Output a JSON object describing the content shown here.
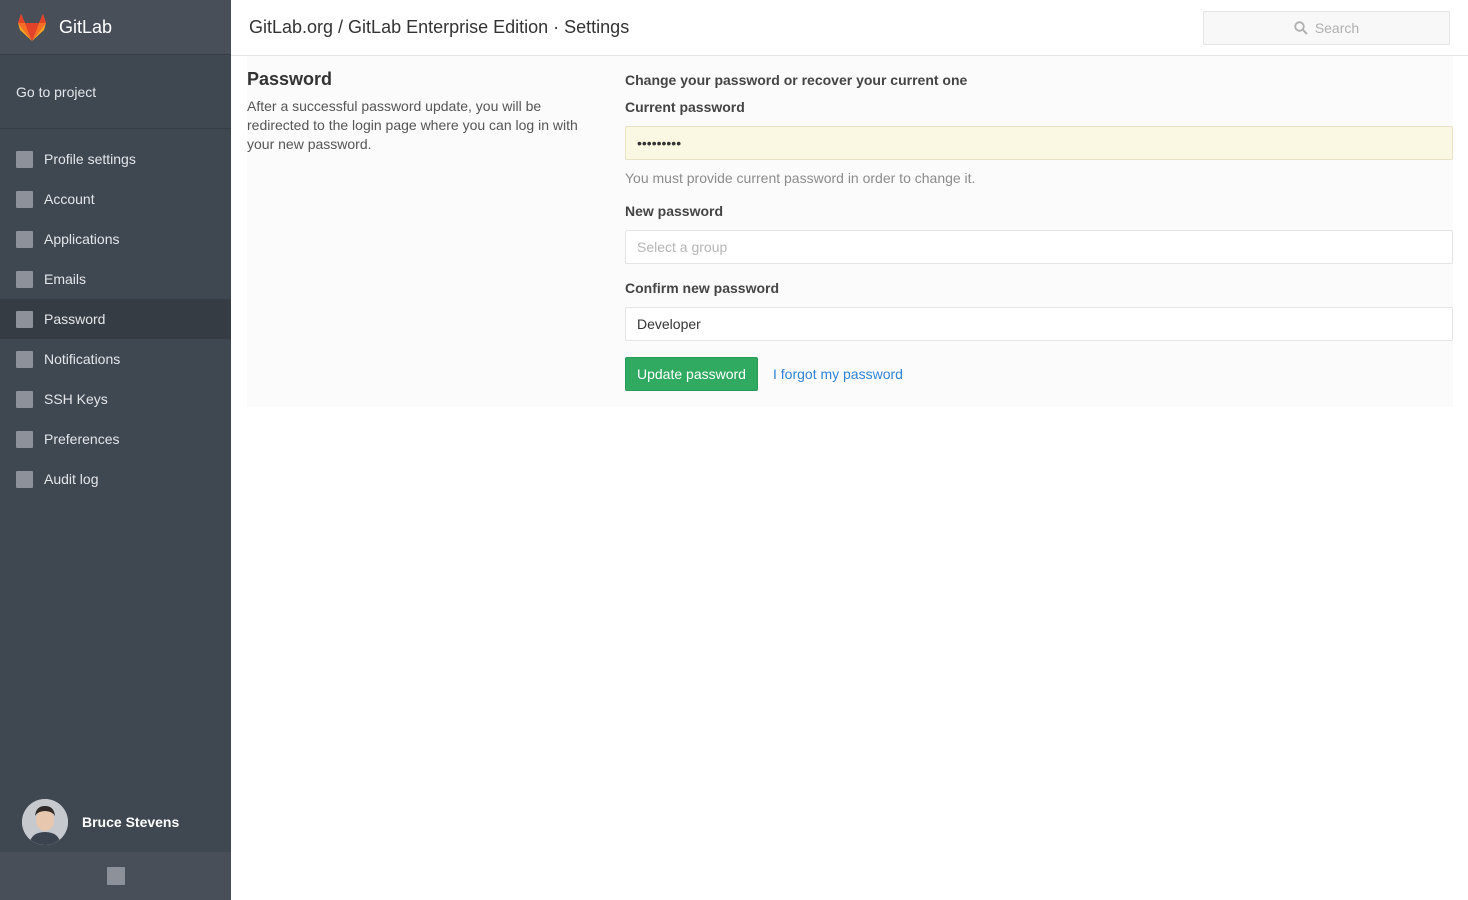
{
  "sidebar": {
    "brand": "GitLab",
    "go_to_project": "Go to project",
    "items": [
      {
        "label": "Profile settings",
        "icon": "user-icon"
      },
      {
        "label": "Account",
        "icon": "gear-icon"
      },
      {
        "label": "Applications",
        "icon": "cloud-icon"
      },
      {
        "label": "Emails",
        "icon": "envelope-icon"
      },
      {
        "label": "Password",
        "icon": "lock-icon",
        "active": true
      },
      {
        "label": "Notifications",
        "icon": "inbox-icon"
      },
      {
        "label": "SSH Keys",
        "icon": "key-icon"
      },
      {
        "label": "Preferences",
        "icon": "image-icon"
      },
      {
        "label": "Audit log",
        "icon": "history-icon"
      }
    ],
    "user_name": "Bruce Stevens",
    "collapse_icon": "angle-left-icon"
  },
  "header": {
    "title": "GitLab.org / GitLab Enterprise Edition · Settings",
    "search_placeholder": "Search"
  },
  "section": {
    "title": "Password",
    "description": "After a successful password update, you will be redirected to the login page where you can log in with your new password."
  },
  "form": {
    "intro": "Change your password or recover your current one",
    "current_label": "Current password",
    "current_value": "•••••••••",
    "current_help": "You must provide current password in order to change it.",
    "new_label": "New password",
    "new_placeholder": "Select a group",
    "confirm_label": "Confirm new password",
    "confirm_value": "Developer",
    "submit_label": "Update password",
    "forgot_label": "I forgot my password"
  },
  "colors": {
    "sidebar_bg": "#3f4751",
    "accent_green": "#2faa60",
    "link_blue": "#3083d6"
  }
}
